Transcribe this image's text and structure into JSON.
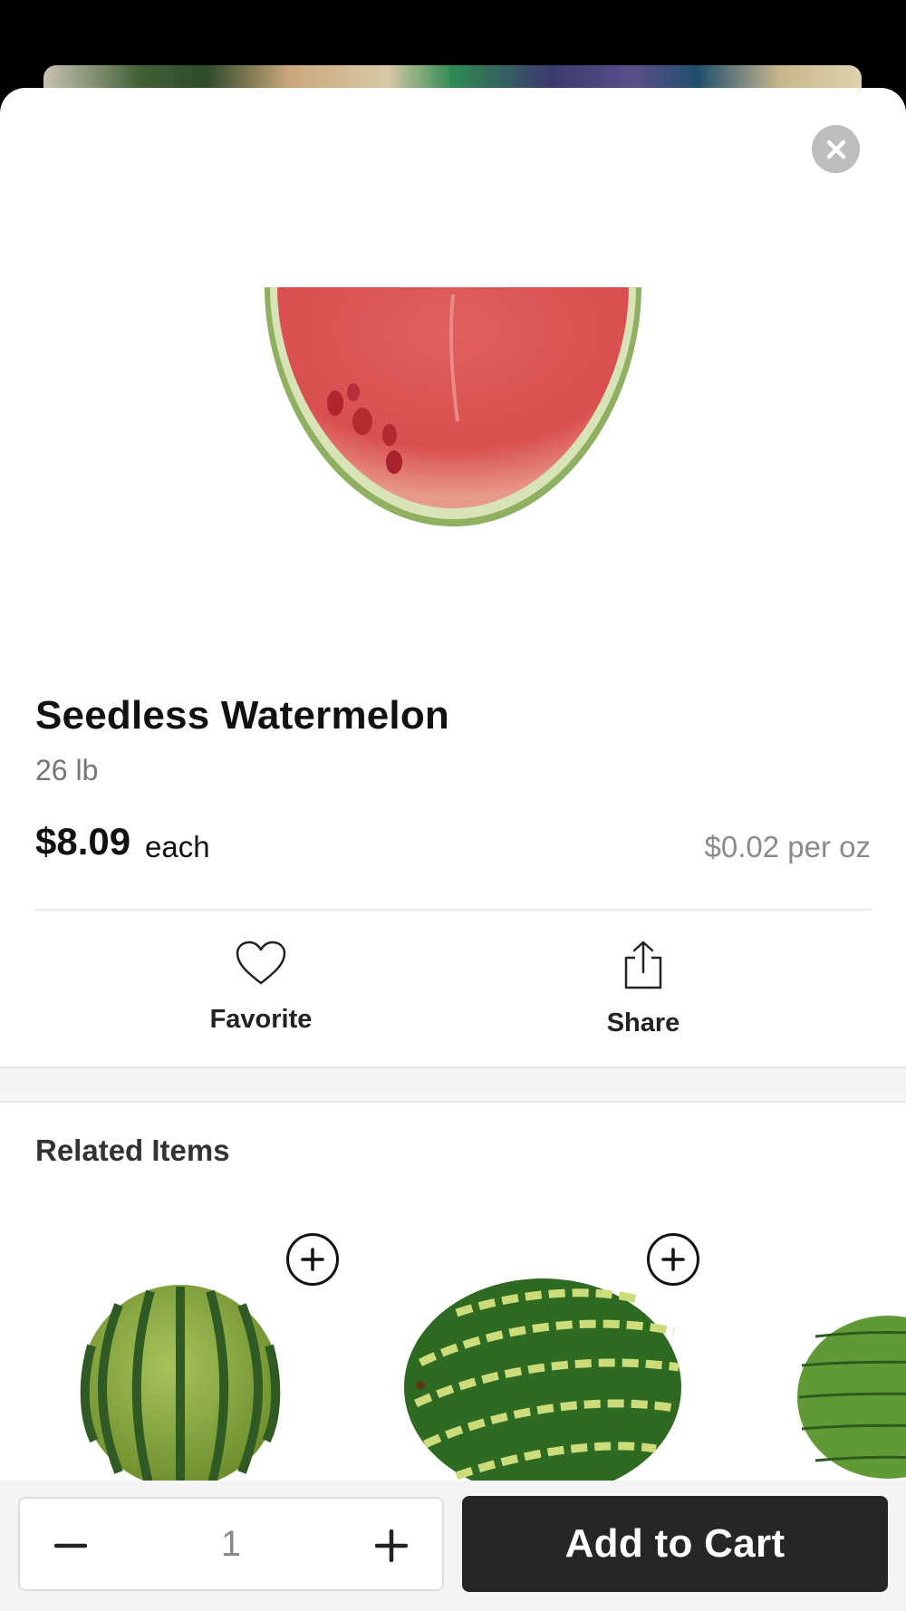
{
  "product": {
    "title": "Seedless Watermelon",
    "size": "26 lb",
    "price": "$8.09",
    "price_unit": "each",
    "unit_price": "$0.02 per oz"
  },
  "actions": {
    "favorite_label": "Favorite",
    "share_label": "Share"
  },
  "related": {
    "title": "Related Items",
    "items": [
      {
        "icon": "plus-circle-icon"
      },
      {
        "icon": "plus-circle-icon"
      },
      {
        "icon": "plus-circle-icon"
      }
    ]
  },
  "cart": {
    "quantity": "1",
    "add_label": "Add to Cart"
  },
  "colors": {
    "accent_dark": "#262626",
    "muted_text": "#767676",
    "close_button": "#bdbdbd"
  }
}
